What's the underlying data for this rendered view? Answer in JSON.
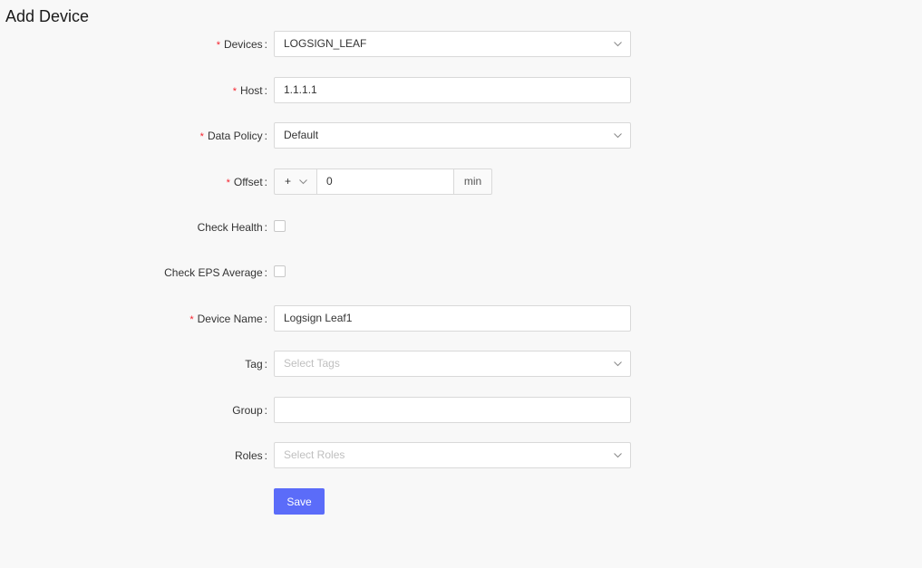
{
  "page": {
    "title": "Add Device"
  },
  "form": {
    "devices": {
      "label": "Devices",
      "required": true,
      "value": "LOGSIGN_LEAF"
    },
    "host": {
      "label": "Host",
      "required": true,
      "value": "1.1.1.1"
    },
    "data_policy": {
      "label": "Data Policy",
      "required": true,
      "value": "Default"
    },
    "offset": {
      "label": "Offset",
      "required": true,
      "sign": "+",
      "value": "0",
      "unit": "min"
    },
    "check_health": {
      "label": "Check Health",
      "checked": false
    },
    "check_eps_average": {
      "label": "Check EPS Average",
      "checked": false
    },
    "device_name": {
      "label": "Device Name",
      "required": true,
      "value": "Logsign Leaf1"
    },
    "tag": {
      "label": "Tag",
      "placeholder": "Select Tags"
    },
    "group": {
      "label": "Group",
      "value": ""
    },
    "roles": {
      "label": "Roles",
      "placeholder": "Select Roles"
    }
  },
  "actions": {
    "save_label": "Save"
  },
  "icons": {
    "select_arrow": "chevron-down-icon"
  },
  "colors": {
    "primary": "#5b6cf9",
    "required": "#f5222d"
  }
}
